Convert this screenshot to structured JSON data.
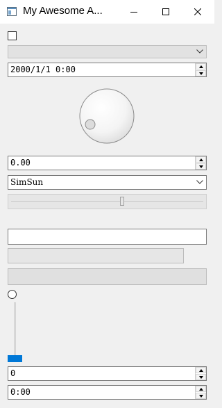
{
  "window": {
    "title": "My Awesome A...",
    "icon": "app-window-icon",
    "caption_buttons": [
      "minimize-icon",
      "maximize-icon",
      "close-icon"
    ]
  },
  "checkbox": {
    "checked": false
  },
  "combo_disabled": {
    "value": "",
    "enabled": false
  },
  "datetime_edit": {
    "value": "2000/1/1 0:00"
  },
  "dial": {
    "value_fraction": 0.0
  },
  "double_spinbox": {
    "value": "0.00"
  },
  "font_combo": {
    "value": "SimSun"
  },
  "horizontal_slider": {
    "value_fraction": 0.58
  },
  "line_edit": {
    "value": ""
  },
  "progress_bar_1": {
    "value": ""
  },
  "progress_bar_2": {
    "value": ""
  },
  "radio": {
    "checked": false
  },
  "vertical_slider": {
    "value_fraction": 0.0
  },
  "spinbox": {
    "value": "0"
  },
  "time_edit": {
    "value": "0:00"
  },
  "colors": {
    "accent": "#0078d7",
    "background": "#f0f0f0"
  }
}
